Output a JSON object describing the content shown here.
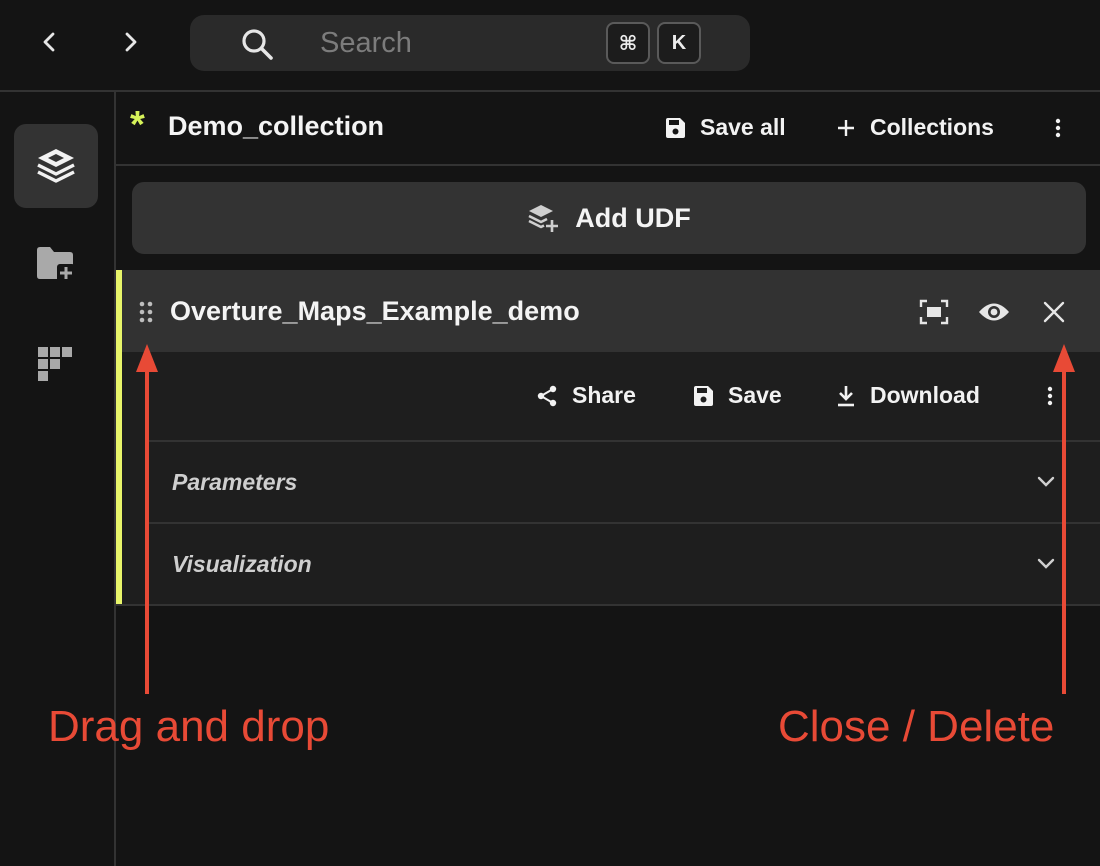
{
  "search": {
    "placeholder": "Search",
    "shortcut_keys": [
      "⌘",
      "K"
    ]
  },
  "collection": {
    "title": "Demo_collection",
    "save_all_label": "Save all",
    "collections_label": "Collections",
    "unsaved_indicator": "*"
  },
  "add_udf": {
    "label": "Add UDF"
  },
  "udf": {
    "title": "Overture_Maps_Example_demo",
    "accent_color": "#e8f56a",
    "actions": {
      "share_label": "Share",
      "save_label": "Save",
      "download_label": "Download"
    },
    "sections": [
      {
        "label": "Parameters"
      },
      {
        "label": "Visualization"
      }
    ]
  },
  "annotations": {
    "left": "Drag and drop",
    "right": "Close / Delete",
    "color": "#e84a36"
  },
  "icons": {
    "nav": [
      "chevron-left-icon",
      "chevron-right-icon"
    ],
    "rail": [
      "layers-icon",
      "folder-add-icon",
      "tetris-blocks-icon"
    ]
  }
}
